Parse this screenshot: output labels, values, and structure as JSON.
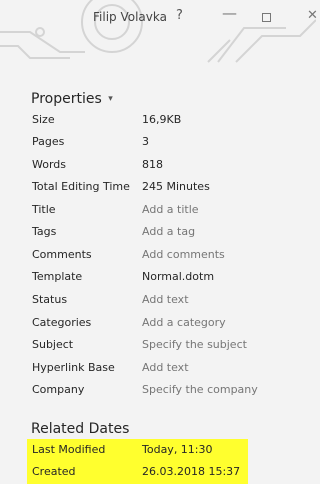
{
  "titlebar": {
    "user_name": "Filip Volavka",
    "help": "?",
    "minimize": "—",
    "close": "✕"
  },
  "properties": {
    "title": "Properties",
    "rows": [
      {
        "label": "Size",
        "value": "16,9KB"
      },
      {
        "label": "Pages",
        "value": "3"
      },
      {
        "label": "Words",
        "value": "818"
      },
      {
        "label": "Total Editing Time",
        "value": "245 Minutes"
      },
      {
        "label": "Title",
        "value": "Add a title"
      },
      {
        "label": "Tags",
        "value": "Add a tag"
      },
      {
        "label": "Comments",
        "value": "Add comments"
      },
      {
        "label": "Template",
        "value": "Normal.dotm"
      },
      {
        "label": "Status",
        "value": "Add text"
      },
      {
        "label": "Categories",
        "value": "Add a category"
      },
      {
        "label": "Subject",
        "value": "Specify the subject"
      },
      {
        "label": "Hyperlink Base",
        "value": "Add text"
      },
      {
        "label": "Company",
        "value": "Specify the company"
      }
    ]
  },
  "related_dates": {
    "title": "Related Dates",
    "rows": [
      {
        "label": "Last Modified",
        "value": "Today, 11:30"
      },
      {
        "label": "Created",
        "value": "26.03.2018 15:37"
      }
    ]
  },
  "colors": {
    "highlight": "#ffff2e",
    "placeholder_text": "#767676"
  }
}
